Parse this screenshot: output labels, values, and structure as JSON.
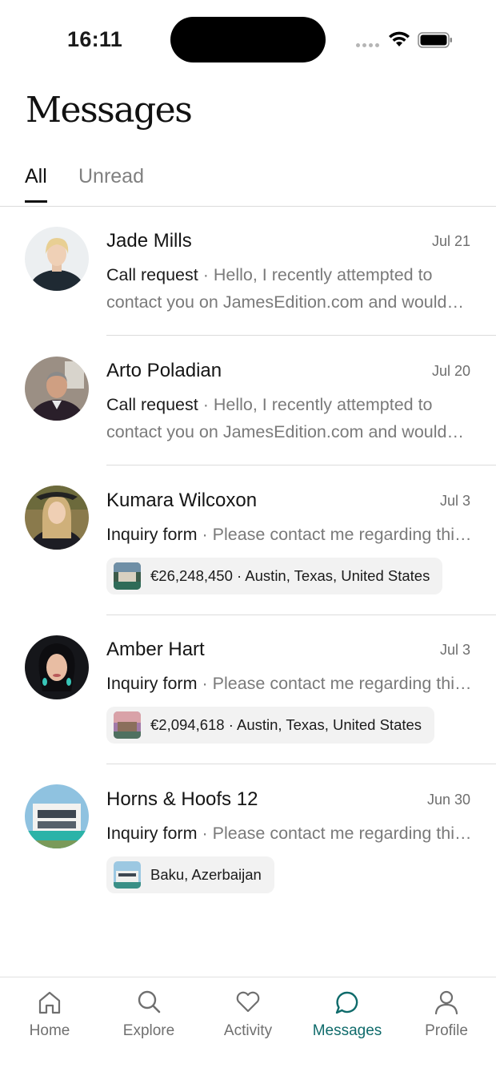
{
  "status_bar": {
    "time": "16:11"
  },
  "page": {
    "title": "Messages"
  },
  "tabs": [
    {
      "label": "All",
      "active": true
    },
    {
      "label": "Unread",
      "active": false
    }
  ],
  "threads": [
    {
      "name": "Jade Mills",
      "date": "Jul 21",
      "kind": "Call request",
      "separator": " · ",
      "preview": "Hello, I recently attempted to contact you on JamesEdition.com and would like to get in touch."
    },
    {
      "name": "Arto Poladian",
      "date": "Jul 20",
      "kind": "Call request",
      "separator": " · ",
      "preview": "Hello, I recently attempted to contact you on JamesEdition.com and would like to get in touch."
    },
    {
      "name": "Kumara Wilcoxon",
      "date": "Jul 3",
      "kind": "Inquiry form",
      "separator": " · ",
      "preview": "Please contact me regarding this listing.",
      "listing": "€26,248,450 · Austin, Texas, United States"
    },
    {
      "name": "Amber Hart",
      "date": "Jul 3",
      "kind": "Inquiry form",
      "separator": " · ",
      "preview": "Please contact me regarding this listing.",
      "listing": "€2,094,618 · Austin, Texas, United States"
    },
    {
      "name": "Horns & Hoofs 12",
      "date": "Jun 30",
      "kind": "Inquiry form",
      "separator": " · ",
      "preview": "Please contact me regarding this listing.",
      "listing": "Baku, Azerbaijan"
    }
  ],
  "bottom_nav": [
    {
      "label": "Home",
      "icon": "home-icon",
      "active": false
    },
    {
      "label": "Explore",
      "icon": "search-icon",
      "active": false
    },
    {
      "label": "Activity",
      "icon": "heart-icon",
      "active": false
    },
    {
      "label": "Messages",
      "icon": "chat-bubble-icon",
      "active": true
    },
    {
      "label": "Profile",
      "icon": "person-icon",
      "active": false
    }
  ],
  "colors": {
    "accent": "#0f6b6b",
    "text_primary": "#151515",
    "text_secondary": "#7a7a7a",
    "divider": "#dcdcdc",
    "chip_bg": "#f2f2f2"
  }
}
